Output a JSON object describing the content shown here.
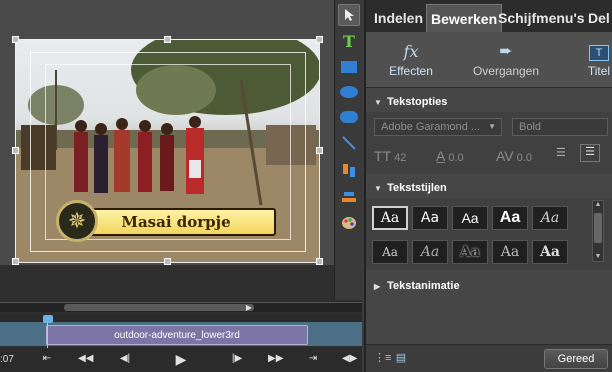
{
  "monitor": {
    "title_text": "Masai dorpje"
  },
  "timeline": {
    "timecode": ":07",
    "clip_label": "outdoor-adventure_lower3rd"
  },
  "panel": {
    "tabs": [
      "Indelen",
      "Bewerken",
      "Schijfmenu's",
      "Del"
    ],
    "subtabs": [
      {
        "label": "Effecten",
        "icon": "fx-icon"
      },
      {
        "label": "Overgangen",
        "icon": "transition-icon"
      },
      {
        "label": "Titel",
        "icon": "title-icon"
      }
    ],
    "text_options": {
      "header": "Tekstopties",
      "font": "Adobe Garamond ...",
      "weight": "Bold",
      "size": "42",
      "leading": "0.0",
      "kerning": "0.0"
    },
    "text_styles": {
      "header": "Tekststijlen",
      "sample": "Aa"
    },
    "text_animation": {
      "header": "Tekstanimatie"
    },
    "done_label": "Gereed"
  },
  "colors": {
    "panel_bg": "#464646",
    "track": "#4b6f85",
    "clip": "#7d74a6",
    "banner": "#f3d55b"
  }
}
